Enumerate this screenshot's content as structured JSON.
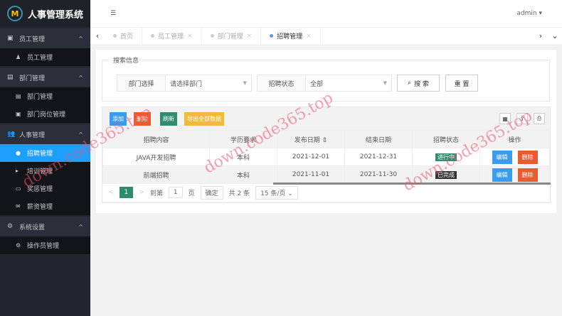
{
  "app": {
    "title": "人事管理系统",
    "logo_mark": "M"
  },
  "header": {
    "user": "admin ▾",
    "menu_icon": "☰"
  },
  "sidebar": [
    {
      "label": "员工管理",
      "icon": "▣",
      "items": [
        {
          "label": "员工管理",
          "icon": "♟"
        }
      ]
    },
    {
      "label": "部门管理",
      "icon": "▤",
      "items": [
        {
          "label": "部门管理",
          "icon": "▤"
        },
        {
          "label": "部门岗位管理",
          "icon": "▣"
        }
      ]
    },
    {
      "label": "人事管理",
      "icon": "👥",
      "items": [
        {
          "label": "招聘管理",
          "icon": "●",
          "active": true
        },
        {
          "label": "培训管理",
          "icon": "▸"
        },
        {
          "label": "奖惩管理",
          "icon": "▭"
        },
        {
          "label": "薪资管理",
          "icon": "✉"
        }
      ]
    },
    {
      "label": "系统设置",
      "icon": "⚙",
      "items": [
        {
          "label": "操作员管理",
          "icon": "⚙"
        }
      ]
    }
  ],
  "tabs": [
    {
      "label": "首页"
    },
    {
      "label": "员工管理"
    },
    {
      "label": "部门管理"
    },
    {
      "label": "招聘管理",
      "active": true
    }
  ],
  "search": {
    "legend": "搜索信息",
    "dept_label": "部门选择",
    "dept_placeholder": "请选择部门",
    "status_label": "招聘状态",
    "status_value": "全部",
    "search_btn": "搜 索",
    "reset_btn": "重 置"
  },
  "toolbar": {
    "add": "添加",
    "delete": "删除",
    "refresh": "刷新",
    "export": "导出全部数据"
  },
  "table": {
    "headers": [
      "招聘内容",
      "学历要求",
      "发布日期 ⇕",
      "结束日期",
      "招聘状态",
      "操作"
    ],
    "rows": [
      {
        "content": "JAVA开发招聘",
        "edu": "本科",
        "start": "2021-12-01",
        "end": "2021-12-31",
        "status": "进行中",
        "status_color": "#2f8c6f"
      },
      {
        "content": "前端招聘",
        "edu": "本科",
        "start": "2021-11-01",
        "end": "2021-11-30",
        "status": "已完成",
        "status_color": "#333333"
      }
    ],
    "edit": "编辑",
    "del": "删除"
  },
  "pager": {
    "prev": "<",
    "page": "1",
    "next": ">",
    "goto": "到第",
    "input": "1",
    "unit": "页",
    "confirm": "确定",
    "total": "共 2 条",
    "size": "15 条/页 ⌄"
  },
  "watermark": "down.code365.top"
}
